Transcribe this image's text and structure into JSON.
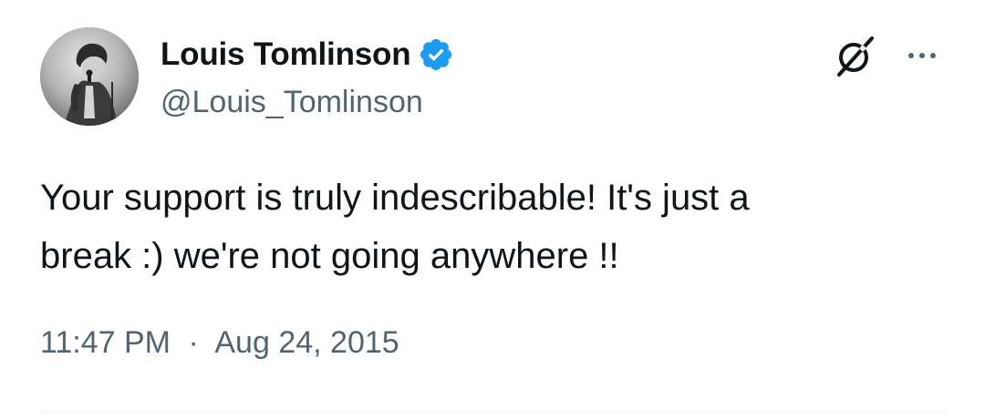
{
  "user": {
    "display_name": "Louis Tomlinson",
    "handle": "@Louis_Tomlinson",
    "verified": true,
    "verified_color": "#1d9bf0"
  },
  "tweet": {
    "text": "Your support is truly indescribable! It's just a\nbreak :) we're not going anywhere !!",
    "time": "11:47 PM",
    "separator": "·",
    "date": "Aug 24, 2015"
  },
  "icons": {
    "verified": "verified-badge-icon",
    "grok": "grok-icon",
    "more": "more-options-icon"
  },
  "colors": {
    "text_primary": "#0f1419",
    "text_secondary": "#536471",
    "accent": "#1d9bf0",
    "divider": "#eff3f4"
  }
}
